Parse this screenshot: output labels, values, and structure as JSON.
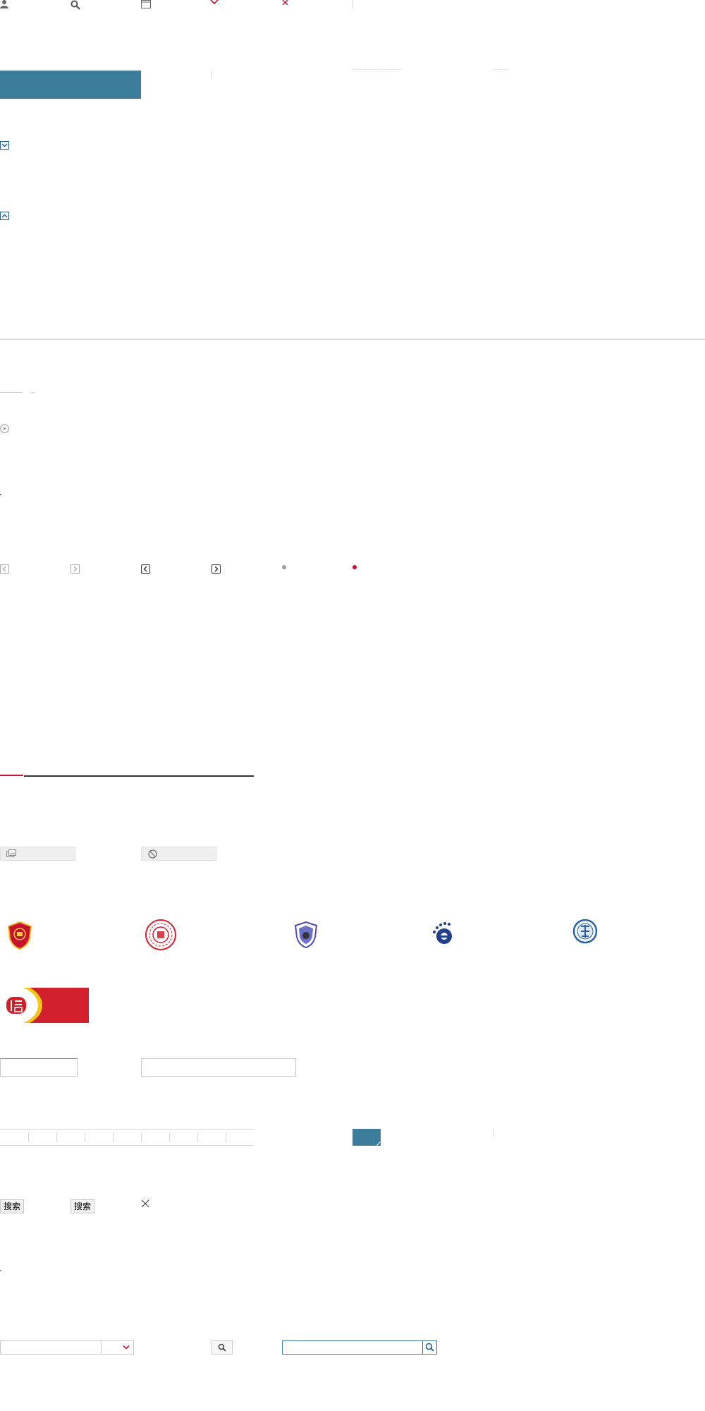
{
  "search_buttons": {
    "search_1": "搜索",
    "search_2": "搜索"
  },
  "icons": [
    "user-icon",
    "search-icon",
    "window-icon",
    "chevron-down-icon",
    "close-icon",
    "expand-down-icon",
    "collapse-up-icon",
    "play-circle-icon",
    "arrow-left-icon",
    "arrow-right-icon",
    "dot-gray-icon",
    "dot-red-icon",
    "gallery-icon",
    "ban-icon",
    "close-thin-icon",
    "select-caret-icon"
  ],
  "colors": {
    "accent_blue": "#3e7c9b",
    "brand_red": "#c8102e",
    "dark_navy": "#1f3f8a"
  }
}
